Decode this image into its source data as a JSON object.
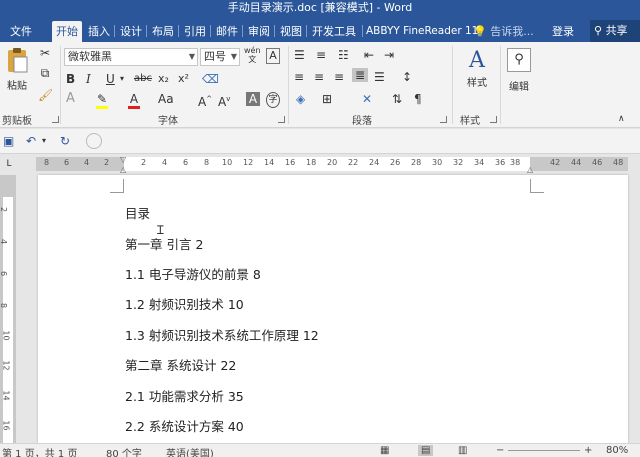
{
  "window": {
    "title": "手动目录演示.doc [兼容模式] - Word"
  },
  "tabs": [
    "文件",
    "开始",
    "插入",
    "设计",
    "布局",
    "引用",
    "邮件",
    "审阅",
    "视图",
    "开发工具",
    "ABBYY FineReader 11"
  ],
  "tell_me": "告诉我...",
  "login": "登录",
  "share": "共享",
  "ribbon": {
    "clipboard": {
      "paste": "粘贴",
      "label": "剪贴板"
    },
    "font": {
      "name": "微软雅黑",
      "size": "四号",
      "wen": "wén",
      "label": "字体"
    },
    "paragraph": {
      "label": "段落"
    },
    "styles": {
      "button": "样式",
      "label": "样式"
    },
    "editing": {
      "button": "编辑"
    }
  },
  "ruler": {
    "left_marks": [
      "8",
      "6",
      "4",
      "2"
    ],
    "right_marks": [
      "2",
      "4",
      "6",
      "8",
      "10",
      "12",
      "14",
      "16",
      "18",
      "20",
      "22",
      "24",
      "26",
      "28",
      "30",
      "32",
      "34",
      "36",
      "38"
    ],
    "far_marks": [
      "42",
      "44",
      "46",
      "48"
    ],
    "v_marks": [
      "2",
      "4",
      "6",
      "8",
      "10",
      "12",
      "14",
      "16"
    ]
  },
  "document": {
    "lines": [
      "目录",
      "第一章  引言 2",
      "1.1  电子导游仪的前景 8",
      "1.2  射频识别技术 10",
      "1.3  射频识别技术系统工作原理 12",
      "第二章  系统设计 22",
      "2.1  功能需求分析 35",
      "2.2  系统设计方案 40"
    ]
  },
  "status": {
    "page": "第 1 页，共 1 页",
    "words": "80 个字",
    "language": "英语(美国)",
    "zoom": "80%"
  }
}
